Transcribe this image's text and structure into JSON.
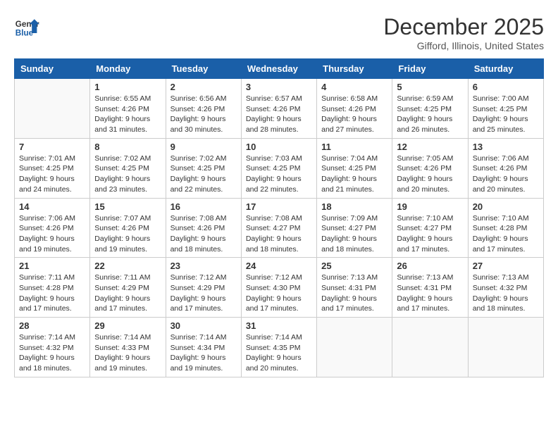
{
  "header": {
    "logo_line1": "General",
    "logo_line2": "Blue",
    "month": "December 2025",
    "location": "Gifford, Illinois, United States"
  },
  "weekdays": [
    "Sunday",
    "Monday",
    "Tuesday",
    "Wednesday",
    "Thursday",
    "Friday",
    "Saturday"
  ],
  "weeks": [
    [
      {
        "day": "",
        "info": ""
      },
      {
        "day": "1",
        "info": "Sunrise: 6:55 AM\nSunset: 4:26 PM\nDaylight: 9 hours\nand 31 minutes."
      },
      {
        "day": "2",
        "info": "Sunrise: 6:56 AM\nSunset: 4:26 PM\nDaylight: 9 hours\nand 30 minutes."
      },
      {
        "day": "3",
        "info": "Sunrise: 6:57 AM\nSunset: 4:26 PM\nDaylight: 9 hours\nand 28 minutes."
      },
      {
        "day": "4",
        "info": "Sunrise: 6:58 AM\nSunset: 4:26 PM\nDaylight: 9 hours\nand 27 minutes."
      },
      {
        "day": "5",
        "info": "Sunrise: 6:59 AM\nSunset: 4:25 PM\nDaylight: 9 hours\nand 26 minutes."
      },
      {
        "day": "6",
        "info": "Sunrise: 7:00 AM\nSunset: 4:25 PM\nDaylight: 9 hours\nand 25 minutes."
      }
    ],
    [
      {
        "day": "7",
        "info": "Sunrise: 7:01 AM\nSunset: 4:25 PM\nDaylight: 9 hours\nand 24 minutes."
      },
      {
        "day": "8",
        "info": "Sunrise: 7:02 AM\nSunset: 4:25 PM\nDaylight: 9 hours\nand 23 minutes."
      },
      {
        "day": "9",
        "info": "Sunrise: 7:02 AM\nSunset: 4:25 PM\nDaylight: 9 hours\nand 22 minutes."
      },
      {
        "day": "10",
        "info": "Sunrise: 7:03 AM\nSunset: 4:25 PM\nDaylight: 9 hours\nand 22 minutes."
      },
      {
        "day": "11",
        "info": "Sunrise: 7:04 AM\nSunset: 4:25 PM\nDaylight: 9 hours\nand 21 minutes."
      },
      {
        "day": "12",
        "info": "Sunrise: 7:05 AM\nSunset: 4:26 PM\nDaylight: 9 hours\nand 20 minutes."
      },
      {
        "day": "13",
        "info": "Sunrise: 7:06 AM\nSunset: 4:26 PM\nDaylight: 9 hours\nand 20 minutes."
      }
    ],
    [
      {
        "day": "14",
        "info": "Sunrise: 7:06 AM\nSunset: 4:26 PM\nDaylight: 9 hours\nand 19 minutes."
      },
      {
        "day": "15",
        "info": "Sunrise: 7:07 AM\nSunset: 4:26 PM\nDaylight: 9 hours\nand 19 minutes."
      },
      {
        "day": "16",
        "info": "Sunrise: 7:08 AM\nSunset: 4:26 PM\nDaylight: 9 hours\nand 18 minutes."
      },
      {
        "day": "17",
        "info": "Sunrise: 7:08 AM\nSunset: 4:27 PM\nDaylight: 9 hours\nand 18 minutes."
      },
      {
        "day": "18",
        "info": "Sunrise: 7:09 AM\nSunset: 4:27 PM\nDaylight: 9 hours\nand 18 minutes."
      },
      {
        "day": "19",
        "info": "Sunrise: 7:10 AM\nSunset: 4:27 PM\nDaylight: 9 hours\nand 17 minutes."
      },
      {
        "day": "20",
        "info": "Sunrise: 7:10 AM\nSunset: 4:28 PM\nDaylight: 9 hours\nand 17 minutes."
      }
    ],
    [
      {
        "day": "21",
        "info": "Sunrise: 7:11 AM\nSunset: 4:28 PM\nDaylight: 9 hours\nand 17 minutes."
      },
      {
        "day": "22",
        "info": "Sunrise: 7:11 AM\nSunset: 4:29 PM\nDaylight: 9 hours\nand 17 minutes."
      },
      {
        "day": "23",
        "info": "Sunrise: 7:12 AM\nSunset: 4:29 PM\nDaylight: 9 hours\nand 17 minutes."
      },
      {
        "day": "24",
        "info": "Sunrise: 7:12 AM\nSunset: 4:30 PM\nDaylight: 9 hours\nand 17 minutes."
      },
      {
        "day": "25",
        "info": "Sunrise: 7:13 AM\nSunset: 4:31 PM\nDaylight: 9 hours\nand 17 minutes."
      },
      {
        "day": "26",
        "info": "Sunrise: 7:13 AM\nSunset: 4:31 PM\nDaylight: 9 hours\nand 17 minutes."
      },
      {
        "day": "27",
        "info": "Sunrise: 7:13 AM\nSunset: 4:32 PM\nDaylight: 9 hours\nand 18 minutes."
      }
    ],
    [
      {
        "day": "28",
        "info": "Sunrise: 7:14 AM\nSunset: 4:32 PM\nDaylight: 9 hours\nand 18 minutes."
      },
      {
        "day": "29",
        "info": "Sunrise: 7:14 AM\nSunset: 4:33 PM\nDaylight: 9 hours\nand 19 minutes."
      },
      {
        "day": "30",
        "info": "Sunrise: 7:14 AM\nSunset: 4:34 PM\nDaylight: 9 hours\nand 19 minutes."
      },
      {
        "day": "31",
        "info": "Sunrise: 7:14 AM\nSunset: 4:35 PM\nDaylight: 9 hours\nand 20 minutes."
      },
      {
        "day": "",
        "info": ""
      },
      {
        "day": "",
        "info": ""
      },
      {
        "day": "",
        "info": ""
      }
    ]
  ]
}
